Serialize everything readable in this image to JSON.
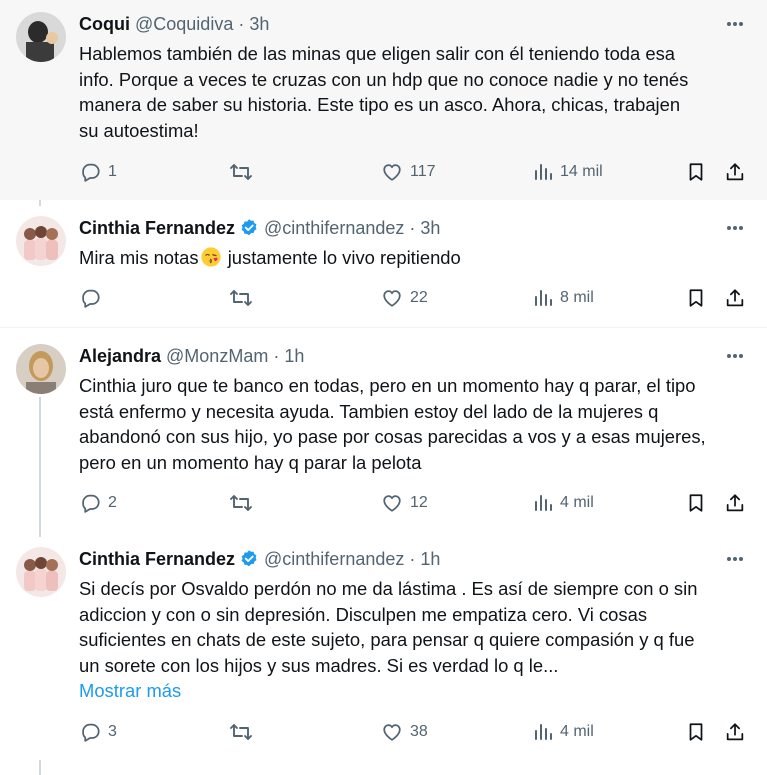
{
  "tweets": [
    {
      "name": "Coqui",
      "handle": "@Coquidiva",
      "time": "3h",
      "verified": false,
      "lines": [
        "Hablemos también de las minas que eligen salir con él teniendo toda esa",
        "info. Porque a veces te cruzas con un hdp que no conoce nadie y no tenés",
        "manera de saber su historia. Este tipo es un asco. Ahora,  chicas, trabajen",
        "su autoestima!"
      ],
      "replies": "1",
      "likes": "117",
      "views": "14 mil"
    },
    {
      "name": "Cinthia Fernandez",
      "handle": "@cinthifernandez",
      "time": "3h",
      "verified": true,
      "text_before_emoji": "Mira mis notas",
      "emoji": "face-blowing-kiss",
      "text_after_emoji": " justamente lo vivo repitiendo",
      "replies": "",
      "likes": "22",
      "views": "8 mil"
    },
    {
      "name": "Alejandra",
      "handle": "@MonzMam",
      "time": "1h",
      "verified": false,
      "lines": [
        "Cinthia juro que te banco en todas, pero en un momento hay q parar, el tipo",
        "está enfermo y necesita ayuda. Tambien estoy del lado de la mujeres q",
        "abandonó con sus hijo, yo pase por cosas parecidas a vos y a esas mujeres,",
        "pero en un momento hay q parar la pelota"
      ],
      "replies": "2",
      "likes": "12",
      "views": "4 mil"
    },
    {
      "name": "Cinthia Fernandez",
      "handle": "@cinthifernandez",
      "time": "1h",
      "verified": true,
      "lines": [
        "Si decís por Osvaldo perdón no me da lástima . Es así de siempre con o sin",
        "adiccion y con o sin depresión. Disculpen me empatiza cero. Vi cosas",
        "suficientes en chats de este sujeto, para pensar q quiere compasión y q fue",
        "un sorete con los hijos y sus madres. Si es verdad lo q le..."
      ],
      "show_more": "Mostrar más",
      "replies": "3",
      "likes": "38",
      "views": "4 mil"
    }
  ],
  "separator": "·",
  "colors": {
    "text": "#0f1419",
    "secondary": "#536471",
    "link": "#1d9bf0",
    "verified": "#1d9bf0",
    "highlight_bg": "#f7f7f7",
    "thread_line": "#cfd9de"
  },
  "icons": [
    "reply-icon",
    "retweet-icon",
    "like-icon",
    "views-icon",
    "bookmark-icon",
    "share-icon",
    "more-icon",
    "verified-badge-icon"
  ]
}
